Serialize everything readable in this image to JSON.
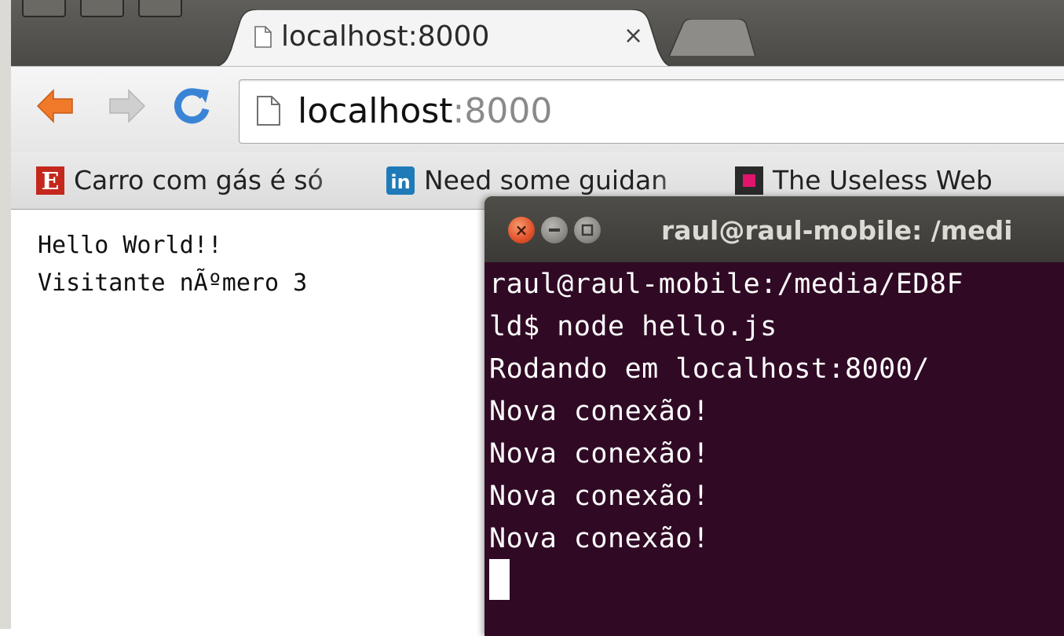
{
  "browser": {
    "tab": {
      "title": "localhost:8000",
      "close_glyph": "×",
      "favicon": "document-icon"
    },
    "omnibox": {
      "host": "localhost",
      "port": ":8000",
      "icon": "document-icon"
    },
    "nav": {
      "back": "back-arrow-icon",
      "forward": "forward-arrow-icon",
      "reload": "reload-icon",
      "back_color": "#f07a2a",
      "forward_color": "#c8c8c8",
      "reload_color": "#3a84d6"
    },
    "bookmarks": [
      {
        "label": "Carro com gás é só",
        "icon": "e-logo-icon",
        "icon_color": "#c4281c"
      },
      {
        "label": "Need some guidan",
        "icon": "linkedin-icon",
        "icon_color": "#1f7bb8"
      },
      {
        "label": "The Useless Web",
        "icon": "useless-web-icon",
        "icon_color": "#e0156b"
      }
    ]
  },
  "page": {
    "lines": [
      "Hello World!!",
      "Visitante nÃºmero 3"
    ]
  },
  "terminal": {
    "title": "raul@raul-mobile: /medi",
    "close_glyph": "×",
    "background": "#300a24",
    "lines": [
      "raul@raul-mobile:/media/ED8F",
      "ld$ node hello.js",
      "Rodando em localhost:8000/",
      "Nova conexão!",
      "Nova conexão!",
      "Nova conexão!",
      "Nova conexão!"
    ]
  }
}
